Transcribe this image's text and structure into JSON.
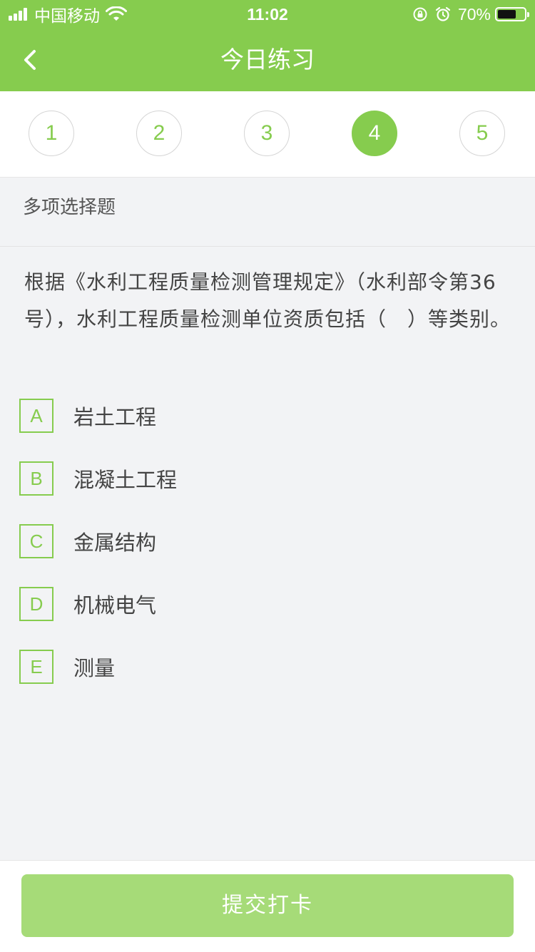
{
  "status_bar": {
    "carrier": "中国移动",
    "time": "11:02",
    "battery_percent": "70%",
    "battery_level": 0.7
  },
  "nav": {
    "title": "今日练习",
    "back_icon": "chevron-left-icon"
  },
  "steps": {
    "items": [
      "1",
      "2",
      "3",
      "4",
      "5"
    ],
    "active_index": 3
  },
  "question": {
    "type": "多项选择题",
    "text": "根据《水利工程质量检测管理规定》（水利部令第36号），水利工程质量检测单位资质包括（　）等类别。",
    "options": [
      {
        "key": "A",
        "text": "岩土工程"
      },
      {
        "key": "B",
        "text": "混凝土工程"
      },
      {
        "key": "C",
        "text": "金属结构"
      },
      {
        "key": "D",
        "text": "机械电气"
      },
      {
        "key": "E",
        "text": "测量"
      }
    ]
  },
  "footer": {
    "submit_label": "提交打卡"
  },
  "colors": {
    "accent": "#86cc4e",
    "button_disabled": "#a6db78",
    "background": "#f2f3f5"
  }
}
